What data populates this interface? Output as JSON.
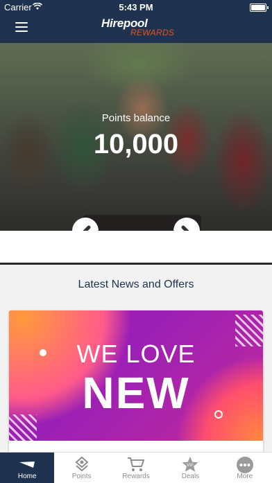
{
  "status": {
    "carrier": "Carrier",
    "time": "5:43 PM"
  },
  "brand": {
    "line1": "Hirepool",
    "line2": "REWARDS"
  },
  "hero": {
    "points_label": "Points balance",
    "points_value": "10,000"
  },
  "news": {
    "title": "Latest News and Offers"
  },
  "card": {
    "line1": "WE LOVE",
    "line2": "NEW"
  },
  "tabs": [
    {
      "label": "Home",
      "icon": "home-icon"
    },
    {
      "label": "Points",
      "icon": "points-icon"
    },
    {
      "label": "Rewards",
      "icon": "cart-icon"
    },
    {
      "label": "Deals",
      "icon": "vip-star-icon",
      "badge": "VIP"
    },
    {
      "label": "More",
      "icon": "more-icon"
    }
  ],
  "colors": {
    "navy": "#1f3350",
    "accent": "#e7541e",
    "tab_inactive": "#8d8d8d"
  }
}
